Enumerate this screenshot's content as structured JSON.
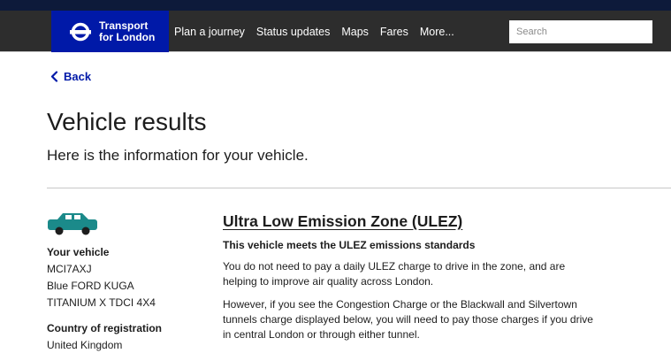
{
  "header": {
    "logo_line1": "Transport",
    "logo_line2": "for London",
    "nav": [
      "Plan a journey",
      "Status updates",
      "Maps",
      "Fares",
      "More..."
    ],
    "search_placeholder": "Search"
  },
  "back_label": "Back",
  "page": {
    "title": "Vehicle results",
    "subtitle": "Here is the information for your vehicle."
  },
  "vehicle": {
    "heading": "Your vehicle",
    "registration": "MCI7AXJ",
    "make": "Blue FORD KUGA",
    "model": "TITANIUM X TDCI 4X4",
    "country_heading": "Country of registration",
    "country": "United Kingdom"
  },
  "ulez": {
    "title": "Ultra Low Emission Zone (ULEZ)",
    "status": "This vehicle meets the ULEZ emissions standards",
    "para1": "You do not need to pay a daily ULEZ charge to drive in the zone, and are helping to improve air quality across London.",
    "para2": "However, if you see the Congestion Charge or the Blackwall and Silvertown tunnels charge displayed below, you will need to pay those charges if you drive in central London or through either tunnel."
  },
  "colors": {
    "brand_blue": "#0019a8",
    "car_teal": "#1b8a8a",
    "nav_bg": "#2d2d2d"
  },
  "icons": [
    "tfl-roundel-icon",
    "chevron-left-icon",
    "car-icon"
  ]
}
